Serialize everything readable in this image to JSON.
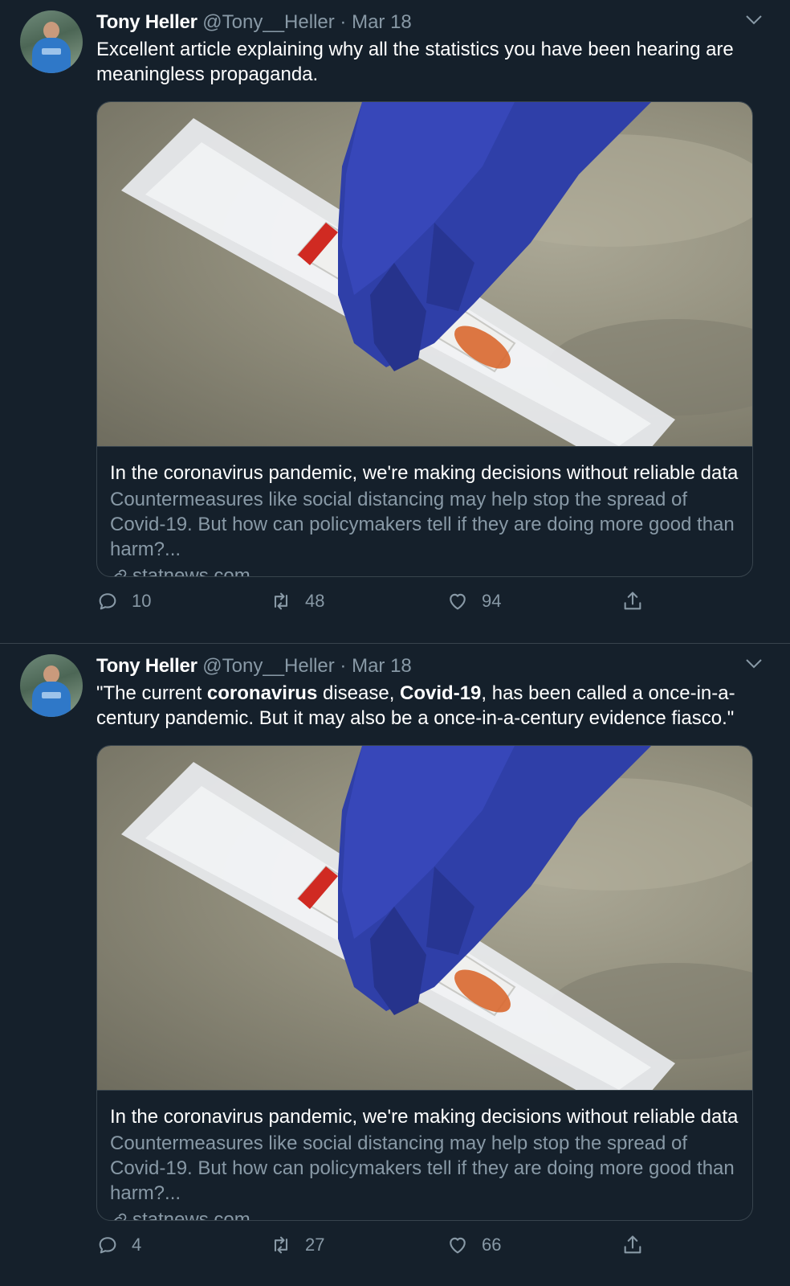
{
  "tweets": [
    {
      "author": {
        "name": "Tony Heller",
        "handle": "@Tony__Heller",
        "separator": "·",
        "date": "Mar 18"
      },
      "text": "Excellent article explaining why all the statistics you have been hearing are meaningless propaganda.",
      "card": {
        "title": "In the coronavirus pandemic, we're making decisions without reliable data",
        "description": "Countermeasures like social distancing may help stop the spread of Covid-19. But how can policymakers tell if they are doing more good than harm?...",
        "domain": "statnews.com"
      },
      "stats": {
        "replies": "10",
        "retweets": "48",
        "likes": "94"
      }
    },
    {
      "author": {
        "name": "Tony Heller",
        "handle": "@Tony__Heller",
        "separator": "·",
        "date": "Mar 18"
      },
      "text_parts": {
        "p1": "\"The current ",
        "b1": "coronavirus",
        "p2": " disease, ",
        "b2": "Covid-19",
        "p3": ", has been called a once-in-a-century pandemic. But it may also be a once-in-a-century evidence fiasco.\""
      },
      "card": {
        "title": "In the coronavirus pandemic, we're making decisions without reliable data",
        "description": "Countermeasures like social distancing may help stop the spread of Covid-19. But how can policymakers tell if they are doing more good than harm?...",
        "domain": "statnews.com"
      },
      "stats": {
        "replies": "4",
        "retweets": "27",
        "likes": "66"
      }
    }
  ],
  "colors": {
    "background": "#15202b",
    "secondary_text": "#8899a6",
    "border": "#38444d",
    "glove": "#2f3fa8",
    "cap": "#d02a22"
  }
}
